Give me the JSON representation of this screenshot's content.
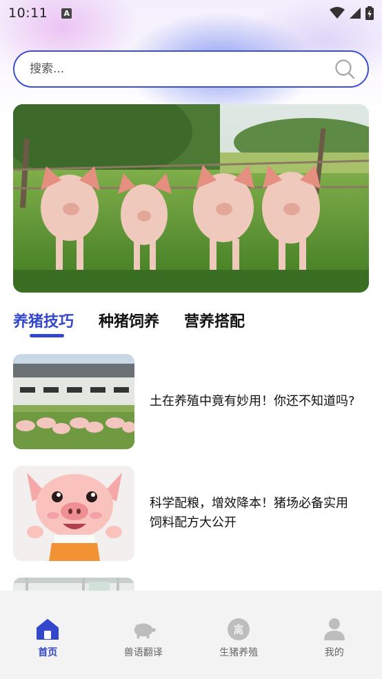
{
  "status_bar": {
    "time": "10:11",
    "notification_icon": "A"
  },
  "search": {
    "placeholder": "搜索..."
  },
  "banner": {
    "image": "pigs-in-field-photo"
  },
  "tabs": [
    {
      "label": "养猪技巧",
      "active": true
    },
    {
      "label": "种猪饲养",
      "active": false
    },
    {
      "label": "营养搭配",
      "active": false
    }
  ],
  "articles": [
    {
      "title": "土在养殖中竟有妙用！你还不知道吗?",
      "thumb": "pig-barn-photo"
    },
    {
      "title": "科学配粮，增效降本！猪场必备实用饲料配方大公开",
      "thumb": "cartoon-pig-image"
    },
    {
      "title": "",
      "thumb": "barn-interior-photo"
    }
  ],
  "bottom_nav": [
    {
      "label": "首页",
      "icon": "home-icon",
      "active": true
    },
    {
      "label": "兽语翻译",
      "icon": "pig-icon",
      "active": false
    },
    {
      "label": "生猪养殖",
      "icon": "livestock-badge-icon",
      "badge": "禽",
      "active": false
    },
    {
      "label": "我的",
      "icon": "user-icon",
      "active": false
    }
  ],
  "colors": {
    "accent": "#3347cc",
    "nav_bg": "#f3f3f3",
    "icon_gray": "#bdbdbd"
  }
}
